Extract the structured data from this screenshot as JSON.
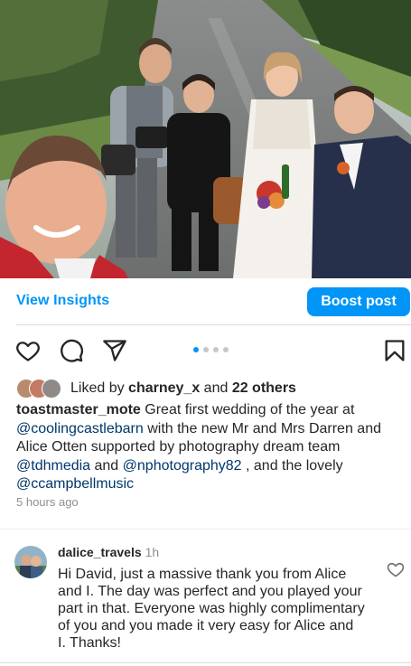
{
  "post": {
    "photo_label": "wedding group selfie photo"
  },
  "insights": {
    "view_label": "View Insights",
    "boost_label": "Boost post"
  },
  "actions": {
    "icons": [
      "heart-icon",
      "comment-icon",
      "share-icon",
      "bookmark-icon"
    ],
    "carousel_count": 4,
    "carousel_active": 1
  },
  "likes": {
    "prefix": "Liked by ",
    "user": "charney_x",
    "middle": " and ",
    "others": "22 others"
  },
  "caption": {
    "username": "toastmaster_mote",
    "text_1": " Great first wedding of the year at ",
    "mention_1": "@coolingcastlebarn",
    "text_2": " with the new Mr and Mrs Darren and Alice Otten supported by photography dream team ",
    "mention_2": "@tdhmedia",
    "text_3": " and ",
    "mention_3": "@nphotography82",
    "text_4": " , and the lovely ",
    "mention_4": "@ccampbellmusic",
    "time": "5 hours ago"
  },
  "comment": {
    "username": "dalice_travels",
    "time": "1h",
    "text": "Hi David, just a massive thank you from Alice and I. The day was perfect and you played your part in that. Everyone was highly complimentary of you and you made it very easy for Alice and I. Thanks!"
  },
  "colors": {
    "accent": "#0095f6",
    "mention": "#00376b",
    "muted": "#8e8e8e"
  }
}
